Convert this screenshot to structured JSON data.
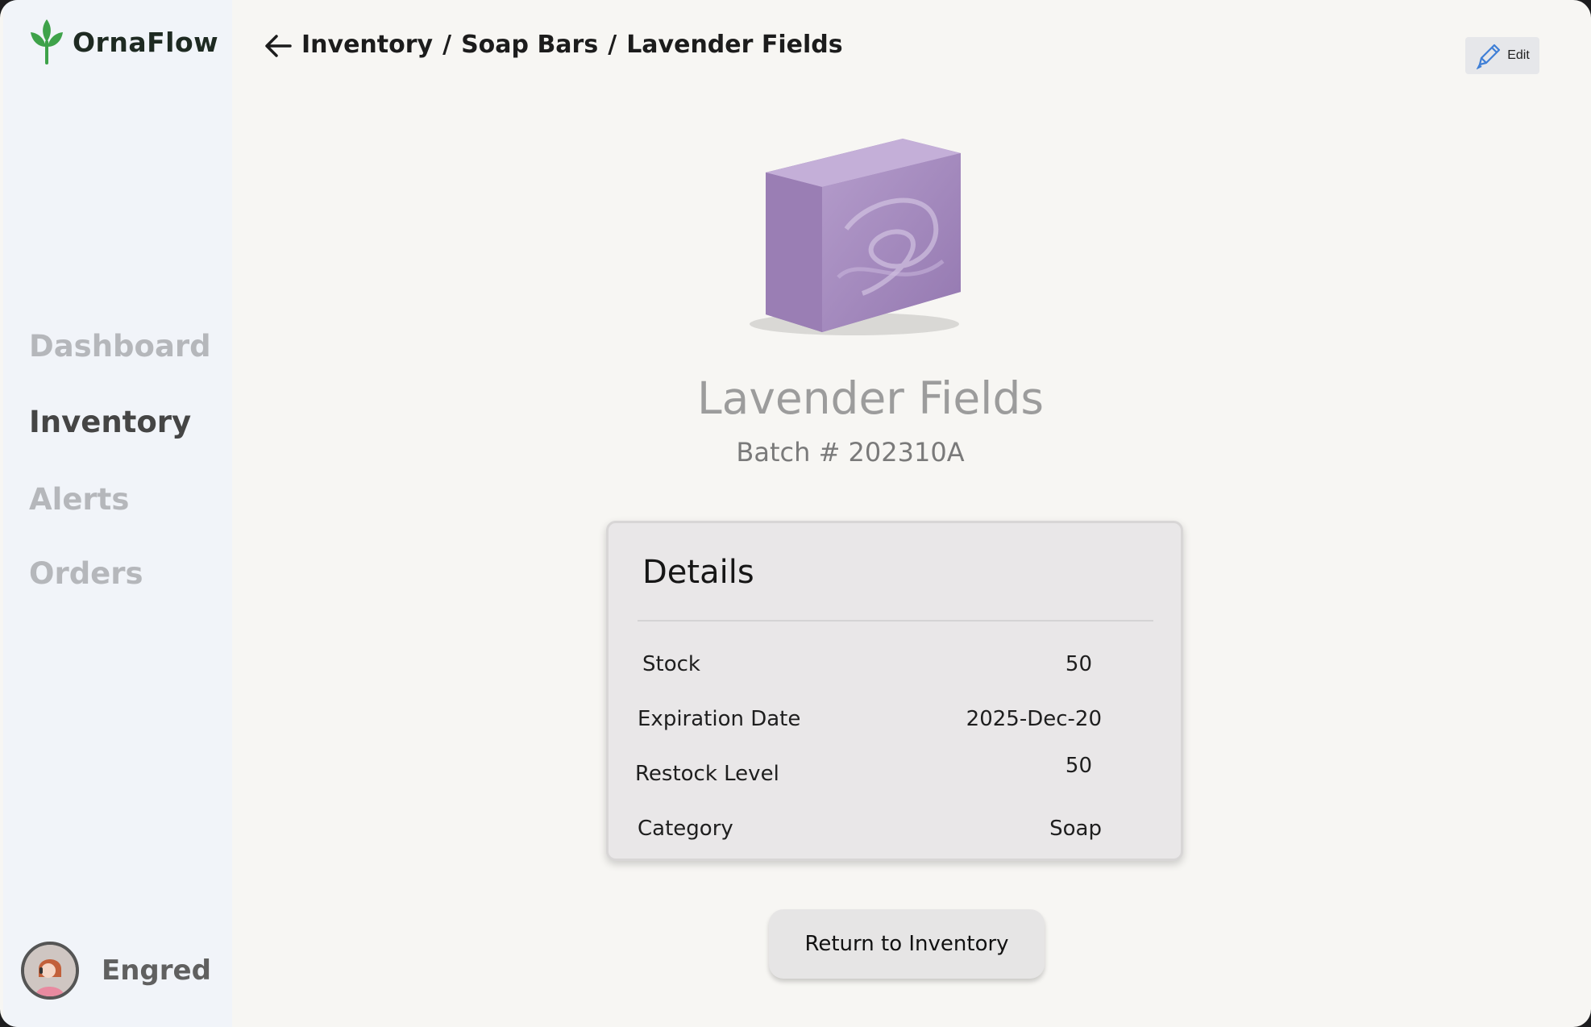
{
  "app": {
    "name": "OrnaFlow",
    "brand_color": "#3ea24a"
  },
  "sidebar": {
    "items": [
      {
        "label": "Dashboard",
        "active": false
      },
      {
        "label": "Inventory",
        "active": true
      },
      {
        "label": "Alerts",
        "active": false
      },
      {
        "label": "Orders",
        "active": false
      }
    ],
    "user": {
      "name": "Engred",
      "avatar_icon": "user-avatar-icon"
    }
  },
  "header": {
    "back_icon": "arrow-left-icon",
    "breadcrumb": [
      "Inventory",
      "Soap Bars",
      "Lavender Fields"
    ],
    "separator": "/",
    "edit_label": "Edit",
    "edit_icon": "pencil-icon",
    "edit_icon_color": "#3f7fd6"
  },
  "product": {
    "name": "Lavender Fields",
    "batch": "Batch # 202310A",
    "image_icon": "soap-bar-image",
    "soap_color": "#a58bbd"
  },
  "details": {
    "title": "Details",
    "rows": [
      {
        "label": "Stock",
        "value": "50"
      },
      {
        "label": "Expiration Date",
        "value": "2025-Dec-20"
      },
      {
        "label": "Restock Level",
        "value": "50"
      },
      {
        "label": "Category",
        "value": "Soap"
      }
    ]
  },
  "actions": {
    "return_label": "Return to Inventory"
  }
}
